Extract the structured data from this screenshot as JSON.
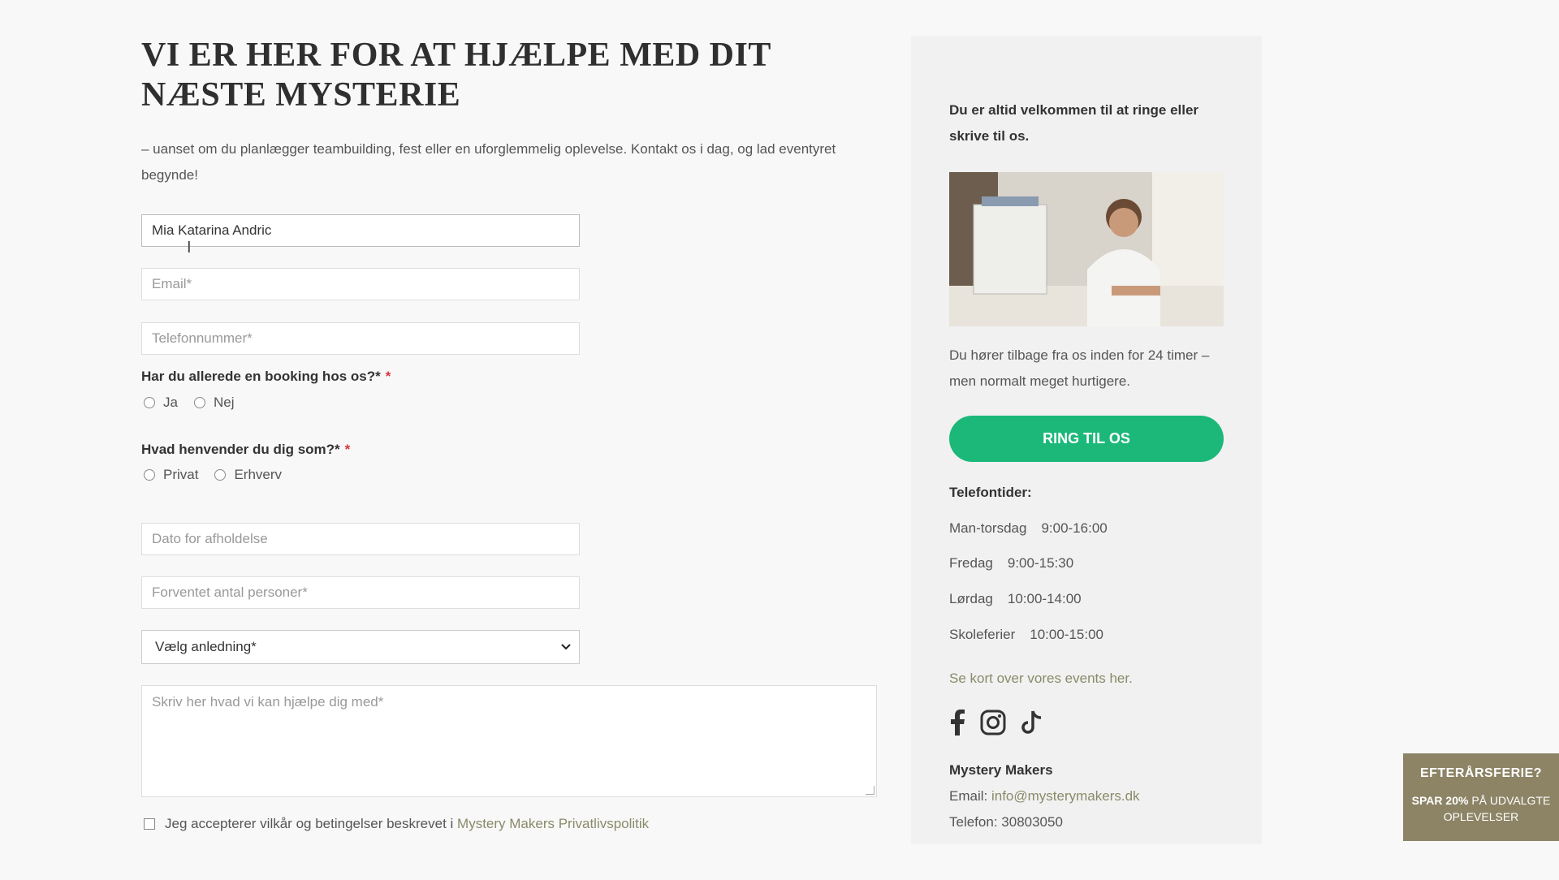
{
  "page": {
    "title": "VI ER HER FOR AT HJÆLPE MED DIT NÆSTE MYSTERIE",
    "intro": "– uanset om du planlægger teambuilding, fest eller en uforglemmelig oplevelse. Kontakt os i dag, og lad eventyret begynde!"
  },
  "form": {
    "name_value": "Mia Katarina Andric",
    "email_placeholder": "Email*",
    "phone_placeholder": "Telefonnummer*",
    "q_booking": "Har du allerede en booking hos os?*",
    "q_booking_req": "*",
    "opt_yes": "Ja",
    "opt_no": "Nej",
    "q_audience": "Hvad henvender du dig som?*",
    "q_audience_req": "*",
    "opt_private": "Privat",
    "opt_business": "Erhverv",
    "date_placeholder": "Dato for afholdelse",
    "persons_placeholder": "Forventet antal personer*",
    "occasion_selected": "Vælg anledning*",
    "message_placeholder": "Skriv her hvad vi kan hjælpe dig med*",
    "accept_text": "Jeg accepterer vilkår og betingelser beskrevet i",
    "accept_link": "Mystery Makers Privatlivspolitik"
  },
  "sidebar": {
    "welcome": "Du er altid velkommen til at ringe eller skrive til os.",
    "reply": "Du hører tilbage fra os inden for 24 timer – men normalt meget hurtigere.",
    "cta": "RING TIL OS",
    "hours_title": "Telefontider:",
    "hours": [
      {
        "day": "Man-torsdag",
        "time": "9:00-16:00"
      },
      {
        "day": "Fredag",
        "time": "9:00-15:30"
      },
      {
        "day": "Lørdag",
        "time": "10:00-14:00"
      },
      {
        "day": "Skoleferier",
        "time": "10:00-15:00"
      }
    ],
    "events_link": "Se kort over vores events her.",
    "company": "Mystery Makers",
    "email_label": "Email:",
    "email_value": "info@mysterymakers.dk",
    "phone_label": "Telefon:",
    "phone_value": "30803050"
  },
  "promo": {
    "title": "EFTERÅRSFERIE?",
    "line_bold": "SPAR 20%",
    "line_rest": "PÅ UDVALGTE OPLEVELSER"
  },
  "colors": {
    "cta": "#1cb87a",
    "required": "#d9363e",
    "promo": "#8d8466",
    "link": "#8a8a6a"
  }
}
